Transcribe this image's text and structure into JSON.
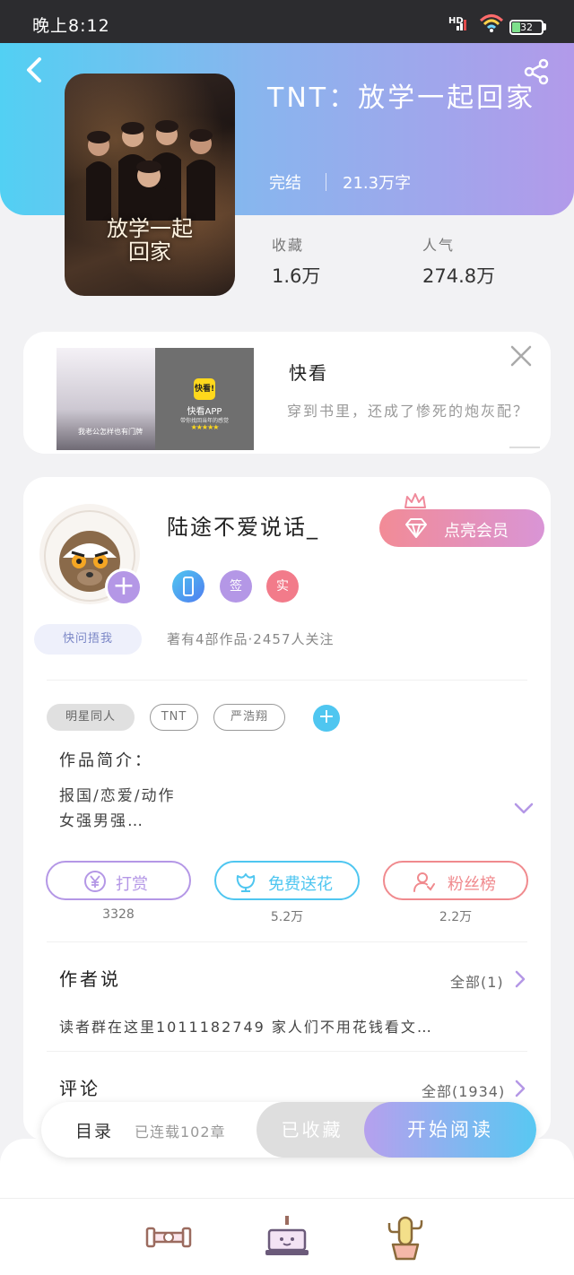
{
  "status_bar": {
    "time": "晚上8:12",
    "network": "HD",
    "battery": "32"
  },
  "book": {
    "title": "TNT：放学一起回家",
    "status": "完结",
    "word_count": "21.3万字",
    "cover_title_line1": "放学一起",
    "cover_title_line2": "回家",
    "stats": {
      "favorites_label": "收藏",
      "favorites_value": "1.6万",
      "popularity_label": "人气",
      "popularity_value": "274.8万"
    }
  },
  "ad": {
    "image_caption": "我老公怎样也有门牌",
    "app_logo": "快看!",
    "app_name": "快看APP",
    "app_tagline": "带你找回当年的感觉",
    "stars": "★★★★★",
    "brand": "快看",
    "description": "穿到书里，还成了惨死的炮灰配？"
  },
  "author": {
    "name": "陆途不爱说话_",
    "vip_button": "点亮会员",
    "fan_badge": "快问捂我",
    "badges": [
      {
        "label": "",
        "color": "#4fa3f0"
      },
      {
        "label": "签",
        "color": "#b497e6"
      },
      {
        "label": "实",
        "color": "#f27b8a"
      }
    ],
    "meta": "著有4部作品·2457人关注",
    "tags": [
      "明星同人",
      "TNT",
      "严浩翔"
    ],
    "intro_label": "作品简介：",
    "intro_line1": "报国/恋爱/动作",
    "intro_line2": "女强男强…",
    "actions": [
      {
        "label": "打赏",
        "count": "3328",
        "color": "#b497e6",
        "icon": "yen-icon"
      },
      {
        "label": "免费送花",
        "count": "5.2万",
        "color": "#4fc6f0",
        "icon": "flower-icon"
      },
      {
        "label": "粉丝榜",
        "count": "2.2万",
        "color": "#f08a8e",
        "icon": "fans-icon"
      }
    ]
  },
  "sections": {
    "author_says_title": "作者说",
    "author_says_more": "全部(1)",
    "author_says_text": "读者群在这里1011182749 家人们不用花钱看文…",
    "comments_title": "评论",
    "comments_more": "全部(1934)"
  },
  "read_bar": {
    "catalog": "目录",
    "catalog_info": "已连载102章",
    "collected": "已收藏",
    "start_read": "开始阅读"
  },
  "bottom_nav": [
    "dumbbell-icon",
    "cake-icon",
    "cactus-icon"
  ]
}
